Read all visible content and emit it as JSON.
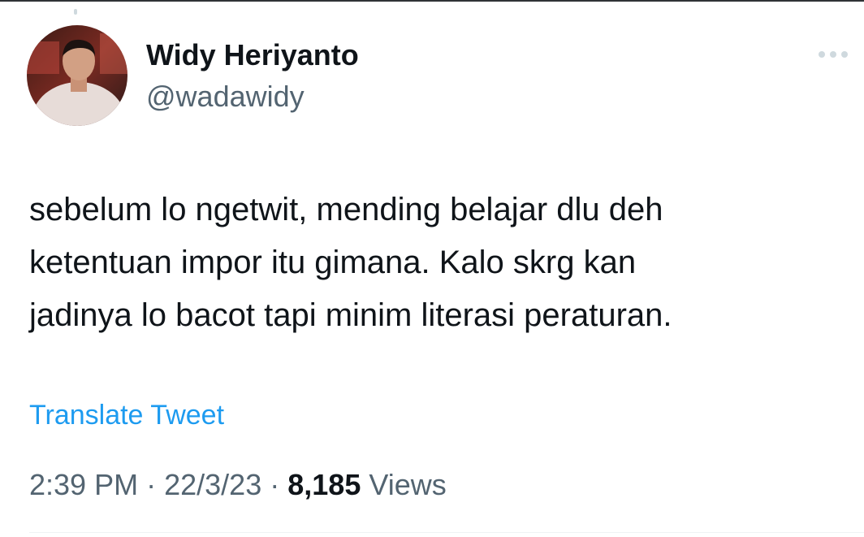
{
  "author": {
    "name": "Widy Heriyanto",
    "handle": "@wadawidy"
  },
  "tweet": {
    "lines": [
      "sebelum lo ngetwit, mending belajar dlu deh",
      "ketentuan impor itu gimana. Kalo skrg kan",
      "jadinya lo bacot tapi minim literasi peraturan."
    ]
  },
  "translate_label": "Translate Tweet",
  "meta": {
    "time": "2:39 PM",
    "separator": "·",
    "date": "22/3/23",
    "views_count": "8,185",
    "views_label": "Views"
  },
  "colors": {
    "link": "#1d9bf0",
    "secondary_text": "#536471",
    "primary_text": "#0f1419"
  },
  "icons": {
    "more": "more-dots-icon",
    "avatar": "profile-photo"
  }
}
